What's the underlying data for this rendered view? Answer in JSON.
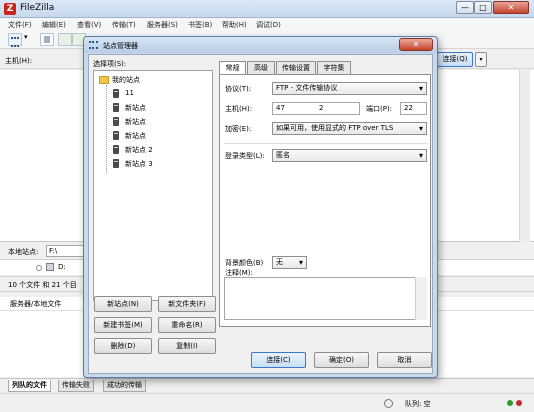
{
  "app": {
    "title": "FileZilla",
    "icon_glyph": "Z",
    "window_buttons": {
      "minimize": "—",
      "maximize": "□",
      "close": "✕"
    }
  },
  "menu": {
    "items": [
      "文件(F)",
      "编辑(E)",
      "查看(V)",
      "传输(T)",
      "服务器(S)",
      "书签(B)",
      "帮助(H)",
      "调试(D)"
    ]
  },
  "toolbar": {
    "dropdown_glyph": "▾"
  },
  "quickconnect": {
    "host_label": "主机(H):",
    "button_label": "连接(Q)",
    "dropdown_glyph": "▾"
  },
  "local": {
    "label": "本地站点:",
    "path": "F:\\",
    "drive_label": "D:",
    "count_text": "10 个文件 和 21 个目"
  },
  "queue": {
    "header": "服务器/本地文件",
    "tabs": [
      "列队的文件",
      "传输失败",
      "成功的传输"
    ],
    "status": "队列: 空"
  },
  "dialog": {
    "title": "站点管理器",
    "close_glyph": "✕",
    "select_label": "选择项(S):",
    "tree": {
      "root": "我的站点",
      "sites": [
        "11",
        "新站点",
        "新站点",
        "新站点",
        "新站点 2",
        "新站点 3"
      ]
    },
    "buttons": {
      "new_site": "新站点(N)",
      "new_folder": "新文件夹(F)",
      "new_bookmark": "新建书签(M)",
      "rename": "重命名(R)",
      "delete": "删除(D)",
      "copy": "复制(I)"
    },
    "tabs": [
      "常规",
      "高级",
      "传输设置",
      "字符集"
    ],
    "general": {
      "protocol_label": "协议(T):",
      "protocol_value": "FTP - 文件传输协议",
      "host_label": "主机(H):",
      "host_value_start": "47",
      "host_value_end": "2",
      "port_label": "端口(P):",
      "port_value": "22",
      "encryption_label": "加密(E):",
      "encryption_value": "如果可用，使用显式的 FTP over TLS",
      "logon_label": "登录类型(L):",
      "logon_value": "匿名",
      "bgcolor_label": "背景颜色(B)",
      "bgcolor_value": "无",
      "comment_label": "注释(M):"
    },
    "footer": {
      "connect": "连接(C)",
      "ok": "确定(O)",
      "cancel": "取消"
    }
  }
}
